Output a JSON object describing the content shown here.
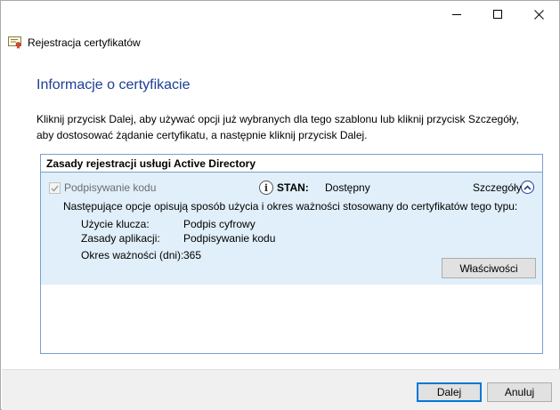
{
  "window": {
    "wizard_title": "Rejestracja certyfikatów",
    "minimize_label": "—",
    "maximize_label": "□",
    "close_label": "✕"
  },
  "page": {
    "heading": "Informacje o certyfikacie",
    "description": "Kliknij przycisk Dalej, aby używać opcji już wybranych dla tego szablonu lub kliknij przycisk Szczegóły, aby dostosować żądanie certyfikatu, a następnie kliknij przycisk Dalej."
  },
  "policy_panel": {
    "header": "Zasady rejestracji usługi Active Directory",
    "item": {
      "name": "Podpisywanie kodu",
      "checked": true,
      "status_label": "STAN:",
      "status_value": "Dostępny",
      "details_label": "Szczegóły",
      "options_intro": "Następujące opcje opisują sposób użycia i okres ważności stosowany do certyfikatów tego typu:",
      "details": [
        {
          "label": "Użycie klucza:",
          "value": "Podpis cyfrowy"
        },
        {
          "label": "Zasady aplikacji:",
          "value": "Podpisywanie kodu"
        },
        {
          "label": "Okres ważności (dni):",
          "value": "365"
        }
      ],
      "properties_button": "Właściwości"
    }
  },
  "footer": {
    "next_button": "Dalej",
    "cancel_button": "Anuluj"
  },
  "colors": {
    "heading": "#1c3f94",
    "panel_border": "#7a9fcf",
    "item_background": "#e0eff9",
    "footer_background": "#f0f0f0",
    "default_button_border": "#0078d7"
  }
}
